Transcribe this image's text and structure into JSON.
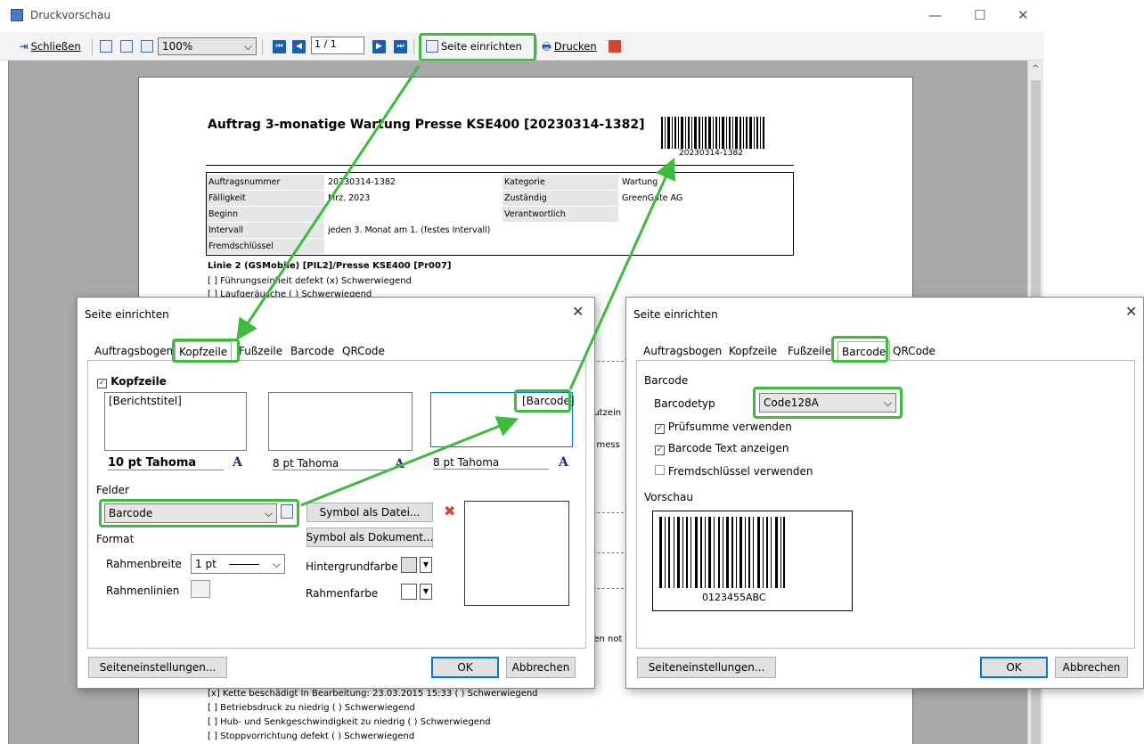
{
  "window": {
    "title": "Druckvorschau"
  },
  "toolbar": {
    "close": "Schließen",
    "zoom": "100%",
    "page": "1 / 1",
    "page_setup": "Seite einrichten",
    "print": "Drucken"
  },
  "document": {
    "title": "Auftrag 3-monatige Wartung Presse KSE400 [20230314-1382]",
    "barcode_text": "20230314-1382",
    "rows": [
      {
        "label": "Auftragsnummer",
        "value": "20230314-1382",
        "label2": "Kategorie",
        "value2": "Wartung"
      },
      {
        "label": "Fälligkeit",
        "value": "Mrz. 2023",
        "label2": "Zuständig",
        "value2": "GreenGate AG"
      },
      {
        "label": "Beginn",
        "value": "",
        "label2": "Verantwortlich",
        "value2": ""
      },
      {
        "label": "Intervall",
        "value": "jeden 3. Monat am 1.  (festes Intervall)",
        "label2": "",
        "value2": ""
      },
      {
        "label": "Fremdschlüssel",
        "value": "",
        "label2": "",
        "value2": ""
      }
    ],
    "section_title": "Linie 2 (GSMobile) [PIL2]/Presse KSE400 [Pr007]",
    "line1": "[ ] Führungseinheit defekt  (x) Schwerwiegend",
    "line2": "[ ] Laufgeräusche  ( ) Schwerwiegend",
    "partial1": "hutzein",
    "partial2": "d mess",
    "partial3": "hen not",
    "bottom_lines": [
      "[x] Kette beschädigt In Bearbeitung: 23.03.2015 15:33  ( ) Schwerwiegend",
      "[ ] Betriebsdruck zu niedrig  ( ) Schwerwiegend",
      "[ ] Hub- und Senkgeschwindigkeit zu niedrig  ( ) Schwerwiegend",
      "[ ] Stoppvorrichtung defekt  ( ) Schwerwiegend"
    ]
  },
  "dialog_left": {
    "title": "Seite einrichten",
    "tabs": [
      "Auftragsbogen",
      "Kopfzeile",
      "Fußzeile",
      "Barcode",
      "QRCode"
    ],
    "header_checkbox": "Kopfzeile",
    "box1_text": "[Berichtstitel]",
    "box3_text": "[Barcode]",
    "font1": "10 pt Tahoma",
    "font2": "8 pt Tahoma",
    "font3": "8 pt Tahoma",
    "font_glyph": "A",
    "fields_label": "Felder",
    "field_value": "Barcode",
    "symbol_file": "Symbol als Datei...",
    "symbol_doc": "Symbol als Dokument...",
    "format_label": "Format",
    "frame_width_label": "Rahmenbreite",
    "frame_width_value": "1 pt",
    "frame_lines_label": "Rahmenlinien",
    "bg_color_label": "Hintergrundfarbe",
    "frame_color_label": "Rahmenfarbe",
    "page_settings": "Seiteneinstellungen...",
    "ok": "OK",
    "cancel": "Abbrechen"
  },
  "dialog_right": {
    "title": "Seite einrichten",
    "tabs": [
      "Auftragsbogen",
      "Kopfzeile",
      "Fußzeile",
      "Barcode",
      "QRCode"
    ],
    "group": "Barcode",
    "type_label": "Barcodetyp",
    "type_value": "Code128A",
    "chk1": "Prüfsumme verwenden",
    "chk2": "Barcode Text anzeigen",
    "chk3": "Fremdschlüssel verwenden",
    "preview_label": "Vorschau",
    "preview_number": "0123455ABC",
    "page_settings": "Seiteneinstellungen...",
    "ok": "OK",
    "cancel": "Abbrechen"
  },
  "colors": {
    "highlight": "#3dbb3d",
    "accent": "#0078d7",
    "nav": "#1a5fb4",
    "delete": "#d9452b"
  }
}
